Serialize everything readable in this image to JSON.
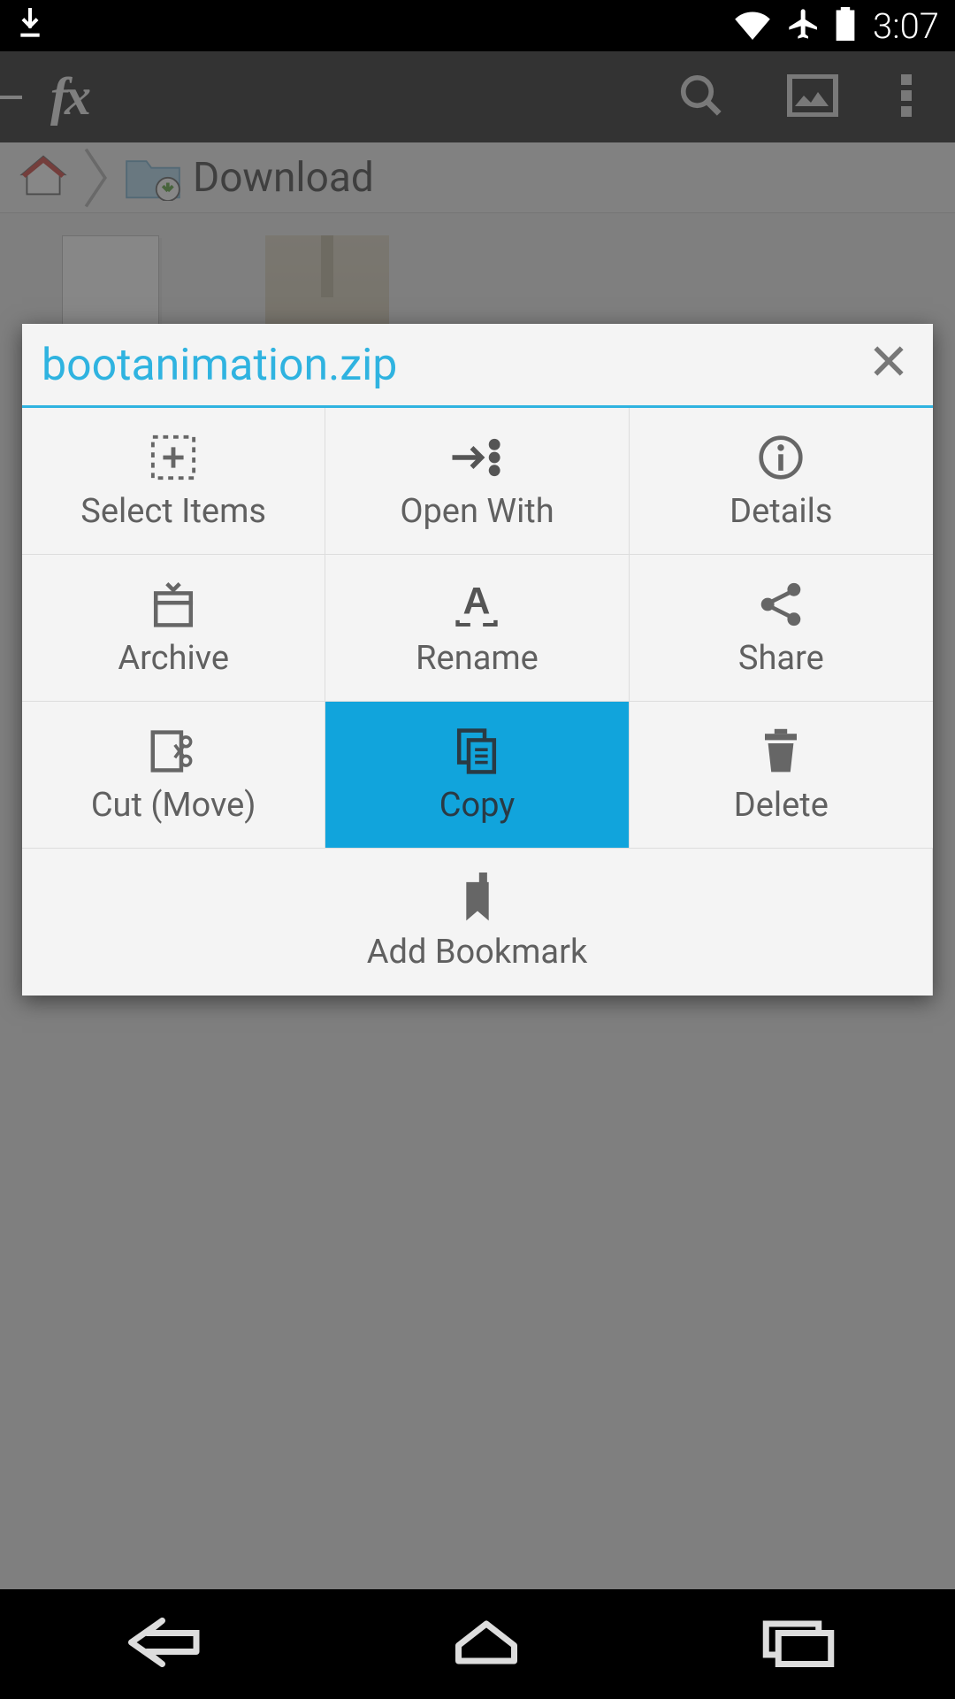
{
  "status": {
    "time": "3:07"
  },
  "breadcrumb": {
    "current": "Download"
  },
  "dialog": {
    "title": "bootanimation.zip",
    "actions": {
      "select_items": "Select Items",
      "open_with": "Open With",
      "details": "Details",
      "archive": "Archive",
      "rename": "Rename",
      "share": "Share",
      "cut": "Cut (Move)",
      "copy": "Copy",
      "delete": "Delete",
      "bookmark": "Add Bookmark"
    }
  }
}
